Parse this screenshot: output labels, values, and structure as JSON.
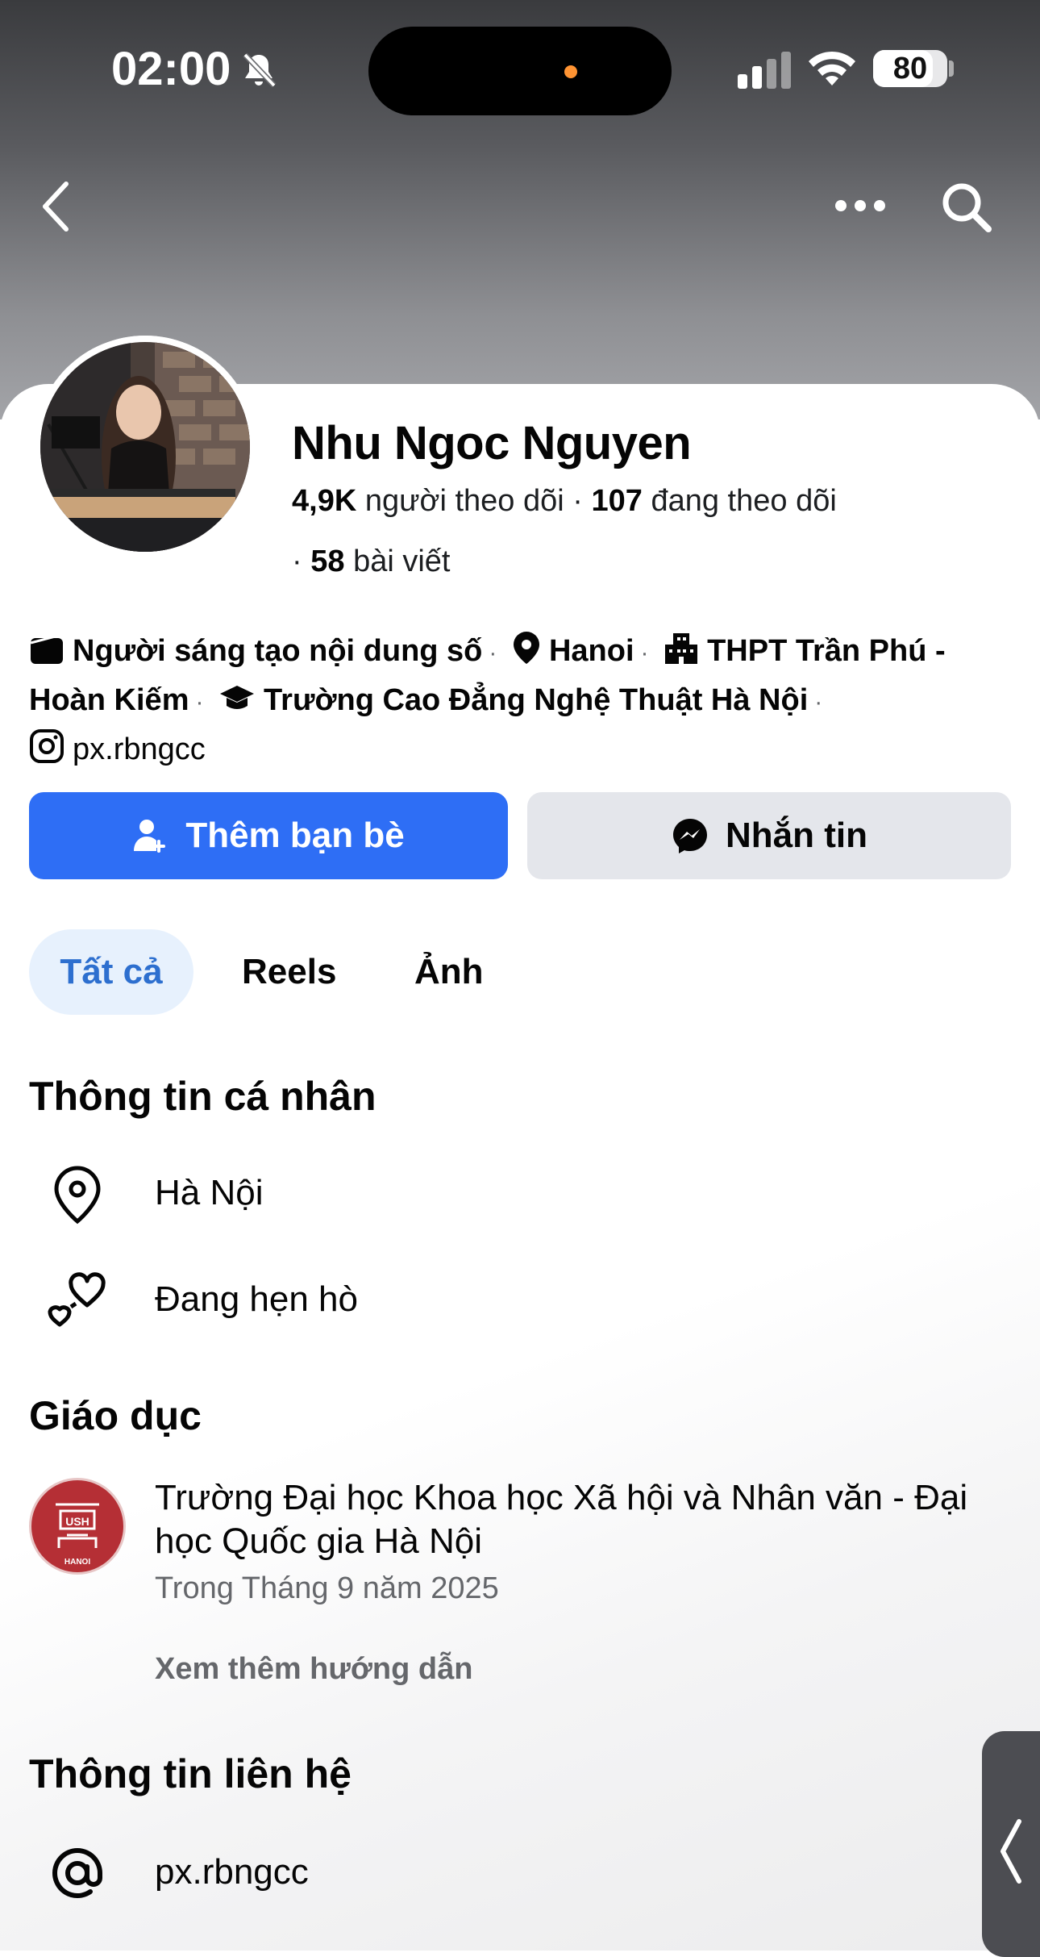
{
  "status_bar": {
    "time": "02:00",
    "battery": "80"
  },
  "profile": {
    "name": "Nhu Ngoc Nguyen",
    "followers_count": "4,9K",
    "followers_label": "người theo dõi",
    "following_count": "107",
    "following_label": "đang theo dõi",
    "posts_count": "58",
    "posts_label": "bài viết"
  },
  "bio": {
    "category": "Người sáng tạo nội dung số",
    "location": "Hanoi",
    "high_school": "THPT Trần Phú - Hoàn Kiếm",
    "college": "Trường Cao Đẳng Nghệ Thuật Hà Nội",
    "instagram": "px.rbngcc"
  },
  "actions": {
    "add_friend": "Thêm bạn bè",
    "message": "Nhắn tin"
  },
  "tabs": [
    {
      "label": "Tất cả",
      "active": true
    },
    {
      "label": "Reels",
      "active": false
    },
    {
      "label": "Ảnh",
      "active": false
    }
  ],
  "personal_info": {
    "title": "Thông tin cá nhân",
    "location": "Hà Nội",
    "relationship": "Đang hẹn hò"
  },
  "education": {
    "title": "Giáo dục",
    "school": "Trường Đại học Khoa học Xã hội và Nhân văn - Đại học Quốc gia Hà Nội",
    "date": "Trong Tháng 9 năm 2025",
    "see_more": "Xem thêm hướng dẫn",
    "logo_text": "HANOI"
  },
  "contact": {
    "title": "Thông tin liên hệ",
    "instagram": "px.rbngcc"
  },
  "colors": {
    "primary": "#2e6ef5",
    "tab_active_text": "#2d6fcf",
    "tab_active_bg": "#e7f1fd",
    "secondary_bg": "#e4e6eb",
    "muted_text": "#65676b"
  }
}
